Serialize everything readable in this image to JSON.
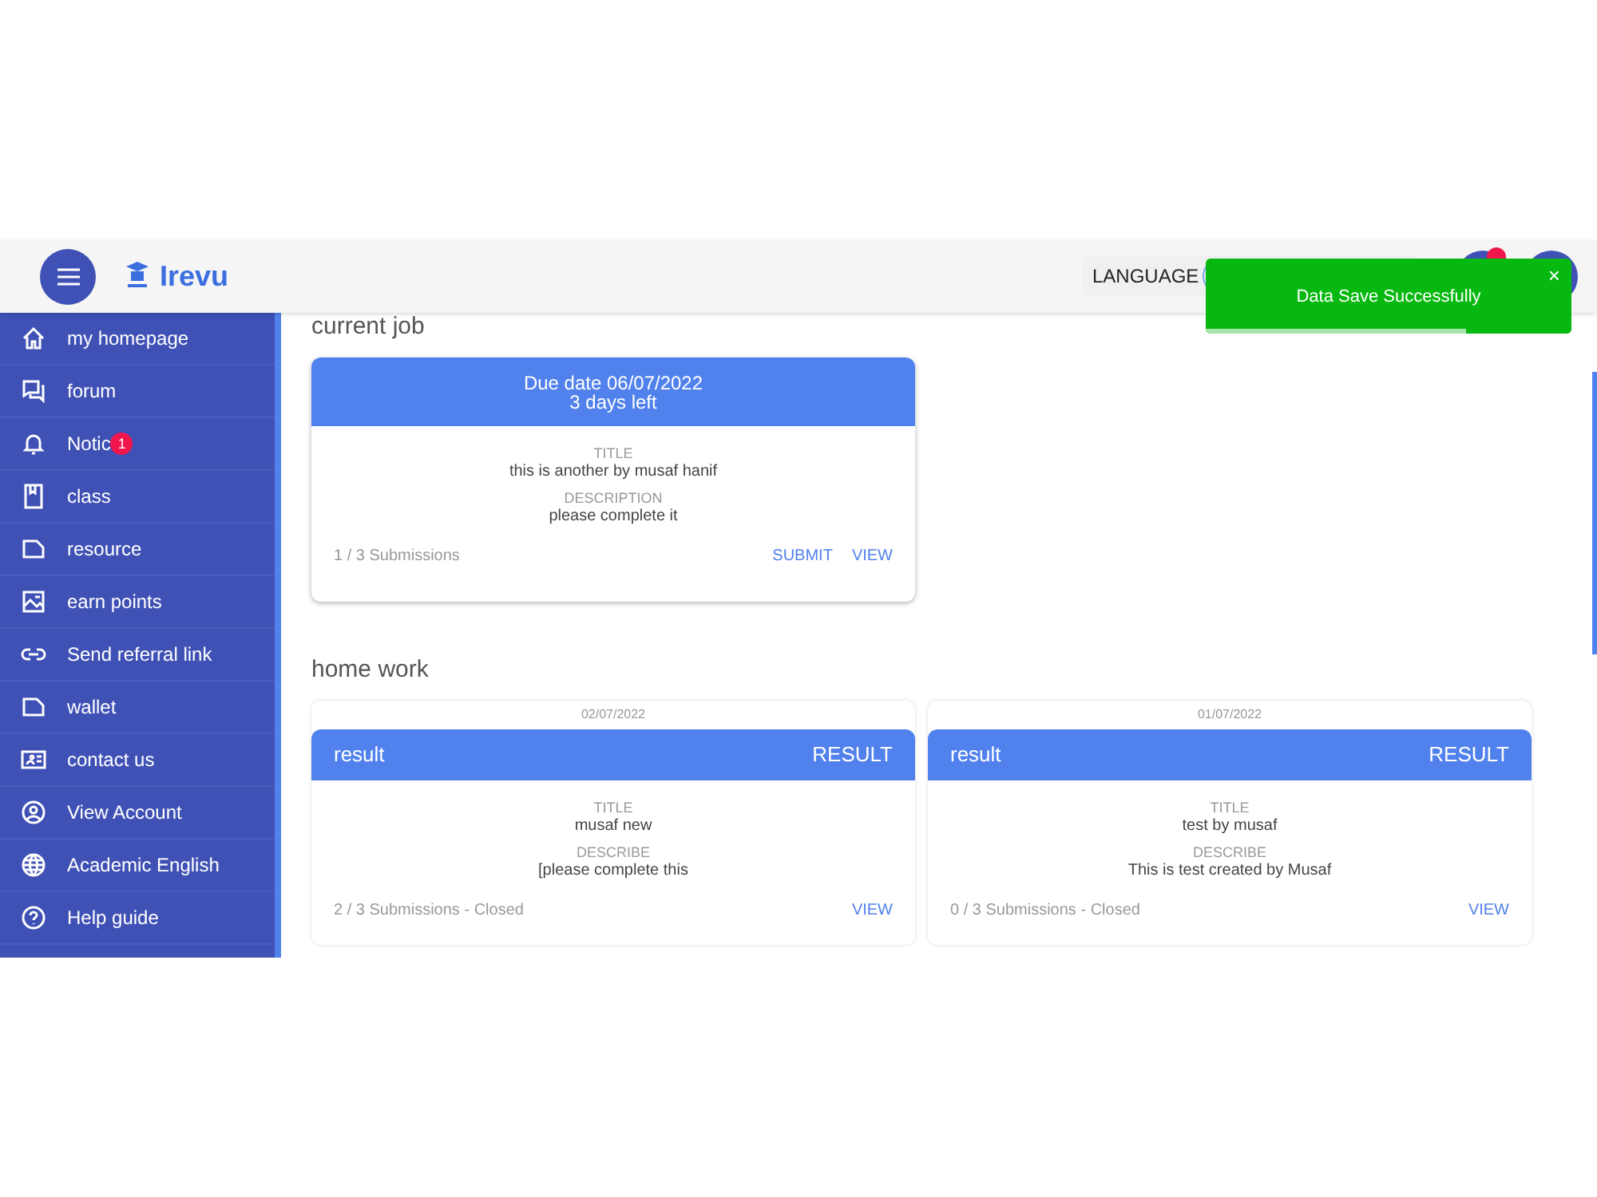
{
  "header": {
    "logo_text": "Irevu",
    "language_label": "LANGUAGE"
  },
  "toast": {
    "message": "Data Save Successfully",
    "close": "×",
    "level": 0.71
  },
  "sidebar": {
    "items": [
      {
        "label": "my homepage"
      },
      {
        "label": "forum"
      },
      {
        "label": "Notic",
        "badge": "1"
      },
      {
        "label": "class"
      },
      {
        "label": "resource"
      },
      {
        "label": "earn points"
      },
      {
        "label": "Send referral link"
      },
      {
        "label": "wallet"
      },
      {
        "label": "contact us"
      },
      {
        "label": "View Account"
      },
      {
        "label": "Academic English"
      },
      {
        "label": "Help guide"
      }
    ]
  },
  "current_job": {
    "heading": "current job",
    "cards": [
      {
        "due": "Due date 06/07/2022",
        "left": "3 days left",
        "title_label": "TITLE",
        "title": "this is another by musaf hanif",
        "desc_label": "DESCRIPTION",
        "desc": "please complete it",
        "submissions": "1 / 3 Submissions",
        "actions": [
          "SUBMIT",
          "VIEW"
        ]
      }
    ]
  },
  "home_work": {
    "heading": "home work",
    "cards": [
      {
        "date": "02/07/2022",
        "name": "result",
        "tag": "RESULT",
        "title_label": "TITLE",
        "title": "musaf new",
        "desc_label": "DESCRIBE",
        "desc": "[please complete this",
        "submissions": "2 / 3 Submissions - Closed",
        "actions": [
          "VIEW"
        ]
      },
      {
        "date": "01/07/2022",
        "name": "result",
        "tag": "RESULT",
        "title_label": "TITLE",
        "title": "test by musaf",
        "desc_label": "DESCRIBE",
        "desc": "This is test created by Musaf",
        "submissions": "0 / 3 Submissions - Closed",
        "actions": [
          "VIEW"
        ]
      }
    ]
  }
}
